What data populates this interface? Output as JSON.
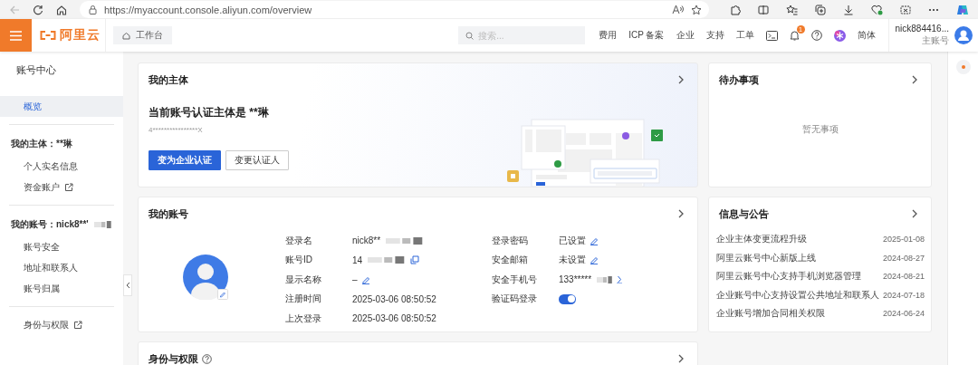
{
  "browser": {
    "url": "https://myaccount.console.aliyun.com/overview"
  },
  "top_nav": {
    "logo_text": "阿里云",
    "home_button": "工作台",
    "search": {
      "placeholder": "搜索..."
    },
    "links": [
      "费用",
      "ICP 备案",
      "企业",
      "支持",
      "工单"
    ],
    "notification_count": "1",
    "language": "简体",
    "user": {
      "name": "nick884416...",
      "role": "主账号"
    }
  },
  "sidebar": {
    "title": "账号中心",
    "sections": [
      {
        "items": [
          {
            "label": "概览",
            "selected": true,
            "external": false
          }
        ]
      },
      {
        "heading": "我的主体：**琳",
        "redacted": false,
        "items": [
          {
            "label": "个人实名信息",
            "selected": false,
            "external": false
          },
          {
            "label": "资金账户",
            "selected": false,
            "external": true
          }
        ]
      },
      {
        "heading": "我的账号：nick8**'",
        "redacted": true,
        "items": [
          {
            "label": "账号安全",
            "selected": false,
            "external": false
          },
          {
            "label": "地址和联系人",
            "selected": false,
            "external": false
          },
          {
            "label": "账号归属",
            "selected": false,
            "external": false
          }
        ]
      },
      {
        "items": [
          {
            "label": "身份与权限",
            "selected": false,
            "external": true
          }
        ]
      }
    ]
  },
  "subject_card": {
    "title": "我的主体",
    "heading": "当前账号认证主体是 **琳",
    "id_number": "4****************X",
    "buttons": [
      {
        "label": "变为企业认证",
        "kind": "primary"
      },
      {
        "label": "变更认证人",
        "kind": "default"
      }
    ]
  },
  "account_card": {
    "title": "我的账号",
    "fields": [
      {
        "label": "登录名",
        "value": "nick8**",
        "redacted": true,
        "kind": "text"
      },
      {
        "label": "登录密码",
        "value": "已设置",
        "redacted": false,
        "kind": "edit"
      },
      {
        "label": "账号ID",
        "value": "14",
        "redacted": true,
        "kind": "copy"
      },
      {
        "label": "安全邮箱",
        "value": "未设置",
        "redacted": false,
        "kind": "edit"
      },
      {
        "label": "显示名称",
        "value": "–",
        "redacted": false,
        "kind": "edit"
      },
      {
        "label": "安全手机号",
        "value": "133*****",
        "redacted": true,
        "kind": "link"
      },
      {
        "label": "注册时间",
        "value": "2025-03-06 08:50:52",
        "redacted": false,
        "kind": "text"
      },
      {
        "label": "验证码登录",
        "kind": "toggle",
        "on": true
      },
      {
        "label": "上次登录",
        "value": "2025-03-06 08:50:52",
        "redacted": false,
        "kind": "text"
      }
    ]
  },
  "identity_card": {
    "title": "身份与权限"
  },
  "todo_card": {
    "title": "待办事项",
    "empty_text": "暂无事项"
  },
  "news_card": {
    "title": "信息与公告",
    "items": [
      {
        "title": "企业主体变更流程升级",
        "date": "2025-01-08"
      },
      {
        "title": "阿里云账号中心新版上线",
        "date": "2024-08-27"
      },
      {
        "title": "阿里云账号中心支持手机浏览器管理",
        "date": "2024-08-21"
      },
      {
        "title": "企业账号中心支持设置公共地址和联系人",
        "date": "2024-07-18"
      },
      {
        "title": "企业账号增加合同相关权限",
        "date": "2024-06-24"
      }
    ]
  }
}
